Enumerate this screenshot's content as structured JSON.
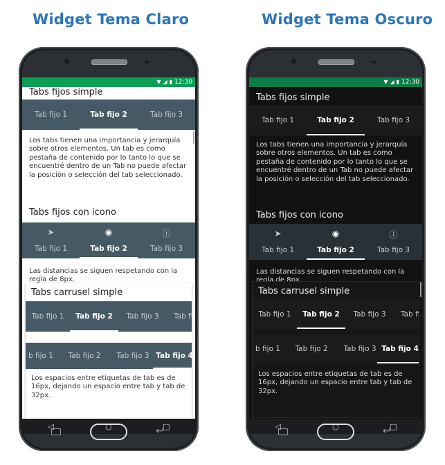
{
  "headings": {
    "light": "Widget Tema Claro",
    "dark": "Widget Tema Oscuro"
  },
  "status": {
    "time": "12:30",
    "wifi_icon": "wifi-icon",
    "signal_icon": "signal-icon",
    "battery_icon": "battery-icon"
  },
  "sections": {
    "fixed_simple": {
      "title": "Tabs fijos simple",
      "tabs": [
        "Tab fijo 1",
        "Tab fijo 2",
        "Tab fijo 3"
      ],
      "active_index": 1,
      "text": "Los tabs tienen una importancia y jerarquía sobre otros elementos. Un tab es como pestaña de contenido por lo tanto lo que se encuentré dentro de un Tab no puede afectar la posición o selección del tab seleccionado."
    },
    "fixed_icon": {
      "title": "Tabs fijos con icono",
      "tabs": [
        {
          "label": "Tab fijo 1",
          "icon": "send-icon"
        },
        {
          "label": "Tab fijo 2",
          "icon": "eye-icon"
        },
        {
          "label": "Tab fijo 3",
          "icon": "info-icon"
        }
      ],
      "active_index": 1,
      "text": "Las distancias se siguen respetando con la regla de 8px."
    },
    "carousel_simple": {
      "title": "Tabs carrusel simple",
      "row1": {
        "tabs": [
          "Tab fijo 1",
          "Tab fijo 2",
          "Tab fijo 3",
          "Tab fij"
        ],
        "active_index": 1
      },
      "row2": {
        "tabs": [
          "b fijo 1",
          "Tab fijo 2",
          "Tab fijo 3",
          "Tab fijo 4"
        ],
        "active_index": 3
      },
      "text": "Los espacios entre etiquetas de tab es de 16px, dejando un espacio entre tab y tab de 32px."
    }
  },
  "navigation": {
    "back_icon": "back-icon",
    "home_icon": "home-icon",
    "recents_icon": "recents-icon"
  },
  "colors": {
    "heading": "#2e75b6",
    "status_bar": "#0f9d58",
    "tab_bar_light": "#455a64",
    "indicator": "#ffffff"
  }
}
